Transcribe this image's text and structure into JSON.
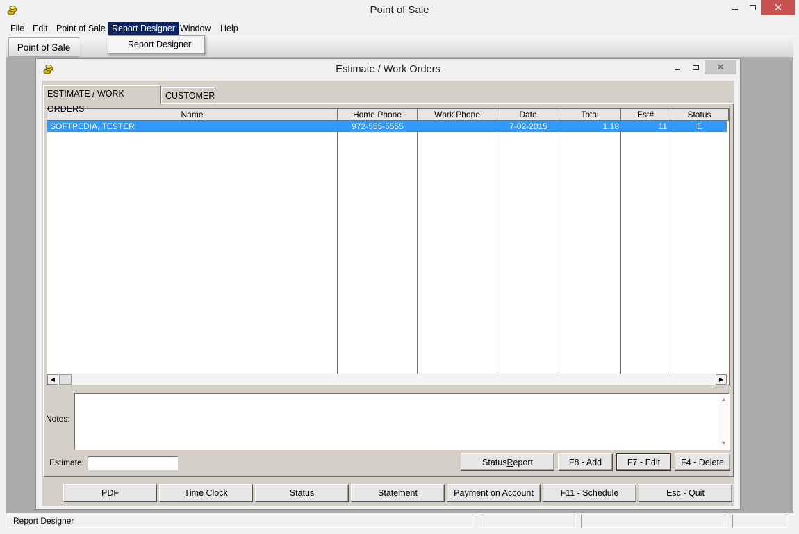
{
  "window": {
    "title": "Point of Sale",
    "close_glyph": "✕"
  },
  "menu": {
    "items": [
      "File",
      "Edit",
      "Point of Sale",
      "Report Designer",
      "Window",
      "Help"
    ],
    "active_index": 3,
    "dropdown_items": [
      "Report Designer"
    ]
  },
  "toolbar": {
    "point_of_sale_label": "Point of Sale"
  },
  "child_window": {
    "title": "Estimate / Work Orders",
    "close_glyph": "✕"
  },
  "tabs": [
    "ESTIMATE / WORK ORDERS",
    "CUSTOMER"
  ],
  "grid": {
    "columns": [
      "Name",
      "Home Phone",
      "Work Phone",
      "Date",
      "Total",
      "Est#",
      "Status"
    ],
    "rows": [
      {
        "name": "SOFTPEDIA, TESTER",
        "home_phone": "972-555-5555",
        "work_phone": "",
        "date": "7-02-2015",
        "total": "1.18",
        "est": "11",
        "status": "E"
      }
    ],
    "selected_color": "#3399ff"
  },
  "notes": {
    "label": "Notes:",
    "value": ""
  },
  "estimate": {
    "label": "Estimate:",
    "value": ""
  },
  "actions": {
    "status_report": {
      "pre": "Status ",
      "u": "R",
      "post": "eport"
    },
    "add": "F8 - Add",
    "edit": "F7 - Edit",
    "delete": "F4 - Delete"
  },
  "bottom_buttons": {
    "pdf": {
      "pre": "PDF",
      "u": "",
      "post": ""
    },
    "time_clock": {
      "pre": "",
      "u": "T",
      "post": "ime Clock"
    },
    "status": {
      "pre": "Stat",
      "u": "u",
      "post": "s"
    },
    "statement": {
      "pre": "St",
      "u": "a",
      "post": "tement"
    },
    "payment_on_account": {
      "pre": "",
      "u": "P",
      "post": "ayment on Account"
    },
    "schedule": {
      "pre": "F11 - Schedule",
      "u": "",
      "post": ""
    },
    "quit": {
      "pre": "Esc - Quit",
      "u": "",
      "post": ""
    }
  },
  "statusbar": {
    "text": "Report Designer"
  },
  "colors": {
    "menu_active": "#0a246a",
    "close_button": "#c75050"
  },
  "icons": {
    "app": "coins-icon",
    "child": "coins-icon"
  }
}
